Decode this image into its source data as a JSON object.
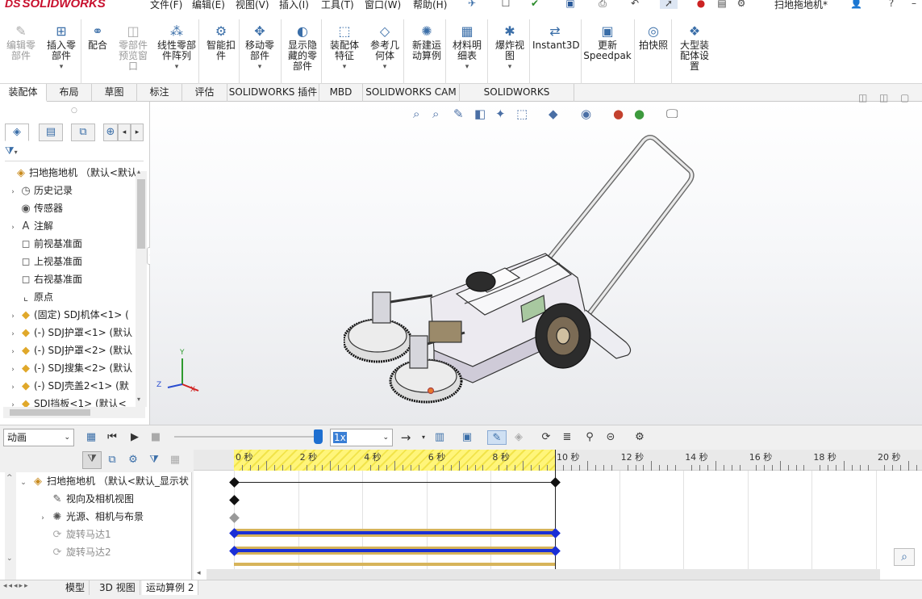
{
  "app": {
    "logo_text": "SOLIDWORKS",
    "logo_prefix": "DS",
    "document_title": "扫地拖地机*"
  },
  "menu": [
    "文件(F)",
    "编辑(E)",
    "视图(V)",
    "插入(I)",
    "工具(T)",
    "窗口(W)",
    "帮助(H)"
  ],
  "ribbon": [
    {
      "label": "编辑零\n部件",
      "icon": "edit-component-icon",
      "disabled": true
    },
    {
      "label": "插入零\n部件",
      "icon": "insert-component-icon",
      "disabled": false
    },
    {
      "label": "配合",
      "icon": "mate-icon",
      "disabled": false
    },
    {
      "label": "零部件\n预览窗\n口",
      "icon": "component-preview-icon",
      "disabled": true
    },
    {
      "label": "线性零部\n件阵列",
      "icon": "linear-pattern-icon",
      "disabled": false
    },
    {
      "label": "智能扣\n件",
      "icon": "smart-fasteners-icon",
      "disabled": false
    },
    {
      "label": "移动零\n部件",
      "icon": "move-component-icon",
      "disabled": false
    },
    {
      "label": "显示隐\n藏的零\n部件",
      "icon": "show-hidden-icon",
      "disabled": false
    },
    {
      "label": "装配体\n特征",
      "icon": "assembly-feature-icon",
      "disabled": false
    },
    {
      "label": "参考几\n何体",
      "icon": "reference-geometry-icon",
      "disabled": false
    },
    {
      "label": "新建运\n动算例",
      "icon": "new-motion-study-icon",
      "disabled": false
    },
    {
      "label": "材料明\n细表",
      "icon": "bom-icon",
      "disabled": false
    },
    {
      "label": "爆炸视\n图",
      "icon": "exploded-view-icon",
      "disabled": false
    },
    {
      "label": "Instant3D",
      "icon": "instant3d-icon",
      "disabled": false
    },
    {
      "label": "更新\nSpeedpak",
      "icon": "speedpak-icon",
      "disabled": false
    },
    {
      "label": "拍快照",
      "icon": "snapshot-icon",
      "disabled": false
    },
    {
      "label": "大型装\n配体设\n置",
      "icon": "large-assembly-icon",
      "disabled": false
    }
  ],
  "tabs": [
    "装配体",
    "布局",
    "草图",
    "标注",
    "评估",
    "SOLIDWORKS 插件",
    "MBD",
    "SOLIDWORKS CAM",
    "SOLIDWORKS Inspection"
  ],
  "feature_tree": [
    {
      "label": "扫地拖地机 （默认<默认_显",
      "icon": "assembly-icon",
      "arrow": ""
    },
    {
      "label": "历史记录",
      "icon": "history-icon",
      "arrow": "›"
    },
    {
      "label": "传感器",
      "icon": "sensor-icon",
      "arrow": ""
    },
    {
      "label": "注解",
      "icon": "annotation-icon",
      "arrow": "›"
    },
    {
      "label": "前视基准面",
      "icon": "plane-icon",
      "arrow": ""
    },
    {
      "label": "上视基准面",
      "icon": "plane-icon",
      "arrow": ""
    },
    {
      "label": "右视基准面",
      "icon": "plane-icon",
      "arrow": ""
    },
    {
      "label": "原点",
      "icon": "origin-icon",
      "arrow": ""
    },
    {
      "label": "(固定) SDJ机体<1> (",
      "icon": "part-icon",
      "arrow": "›"
    },
    {
      "label": "(-) SDJ护罩<1> (默认",
      "icon": "part-icon",
      "arrow": "›"
    },
    {
      "label": "(-) SDJ护罩<2> (默认",
      "icon": "part-icon",
      "arrow": "›"
    },
    {
      "label": "(-) SDJ搜集<2> (默认",
      "icon": "part-icon",
      "arrow": "›"
    },
    {
      "label": "(-) SDJ壳盖2<1> (默",
      "icon": "part-icon",
      "arrow": "›"
    },
    {
      "label": "SDJ挡板<1> (默认<",
      "icon": "part-icon",
      "arrow": "›"
    }
  ],
  "motion": {
    "study_type": "动画",
    "speed": "1x",
    "tree": [
      {
        "label": "扫地拖地机 （默认<默认_显示状",
        "arrow": "⌄",
        "grey": false
      },
      {
        "label": "视向及相机视图",
        "arrow": "",
        "grey": false
      },
      {
        "label": "光源、相机与布景",
        "arrow": "›",
        "grey": false
      },
      {
        "label": "旋转马达1",
        "arrow": "",
        "grey": true
      },
      {
        "label": "旋转马达2",
        "arrow": "",
        "grey": true
      }
    ],
    "ruler": [
      "0 秒",
      "2 秒",
      "4 秒",
      "6 秒",
      "8 秒",
      "10 秒",
      "12 秒",
      "14 秒",
      "16 秒",
      "18 秒",
      "20 秒"
    ]
  },
  "bottom_tabs": [
    "模型",
    "3D 视图",
    "运动算例 2"
  ],
  "axis": {
    "x": "X",
    "y": "Y",
    "z": "Z"
  }
}
